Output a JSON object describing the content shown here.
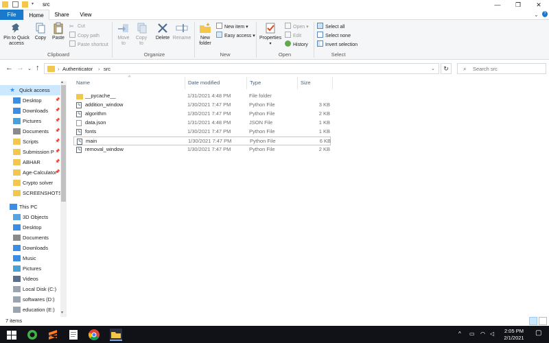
{
  "window": {
    "title": "src",
    "controls": {
      "minimize": "—",
      "maximize": "❐",
      "close": "✕"
    }
  },
  "tabs": {
    "file": "File",
    "home": "Home",
    "share": "Share",
    "view": "View"
  },
  "ribbon": {
    "clipboard": {
      "label": "Clipboard",
      "pin": "Pin to Quick access",
      "copy": "Copy",
      "paste": "Paste",
      "cut": "Cut",
      "copy_path": "Copy path",
      "paste_shortcut": "Paste shortcut"
    },
    "organize": {
      "label": "Organize",
      "move_to": "Move to",
      "copy_to": "Copy to",
      "delete": "Delete",
      "rename": "Rename"
    },
    "new": {
      "label": "New",
      "new_folder": "New folder",
      "new_item": "New item",
      "easy_access": "Easy access"
    },
    "open": {
      "label": "Open",
      "properties": "Properties",
      "open": "Open",
      "edit": "Edit",
      "history": "History"
    },
    "select": {
      "label": "Select",
      "select_all": "Select all",
      "select_none": "Select none",
      "invert": "Invert selection"
    }
  },
  "address": {
    "crumbs": [
      "Authenticator",
      "src"
    ],
    "search_placeholder": "Search src"
  },
  "nav": {
    "quick_access": "Quick access",
    "pinned": [
      {
        "label": "Desktop",
        "icon": "desktop-icon",
        "pinned": true
      },
      {
        "label": "Downloads",
        "icon": "downloads-icon",
        "pinned": true
      },
      {
        "label": "Pictures",
        "icon": "pictures-icon",
        "pinned": true
      },
      {
        "label": "Documents",
        "icon": "documents-icon",
        "pinned": true
      },
      {
        "label": "Scripts",
        "icon": "folder-icon",
        "pinned": true
      },
      {
        "label": "Submission P",
        "icon": "folder-icon",
        "pinned": true
      },
      {
        "label": "ABHAR",
        "icon": "folder-icon",
        "pinned": true
      },
      {
        "label": "Age-Calculator",
        "icon": "folder-icon",
        "pinned": true
      },
      {
        "label": "Crypto solver",
        "icon": "folder-icon",
        "pinned": false
      },
      {
        "label": "SCREENSHOTS",
        "icon": "folder-icon",
        "pinned": false
      }
    ],
    "this_pc": "This PC",
    "pc_items": [
      {
        "label": "3D Objects",
        "icon": "objects-3d-icon"
      },
      {
        "label": "Desktop",
        "icon": "desktop-icon"
      },
      {
        "label": "Documents",
        "icon": "documents-icon"
      },
      {
        "label": "Downloads",
        "icon": "downloads-icon"
      },
      {
        "label": "Music",
        "icon": "music-icon"
      },
      {
        "label": "Pictures",
        "icon": "pictures-icon"
      },
      {
        "label": "Videos",
        "icon": "videos-icon"
      },
      {
        "label": "Local Disk (C:)",
        "icon": "drive-icon"
      },
      {
        "label": "softwares (D:)",
        "icon": "drive-icon"
      },
      {
        "label": "education (E:)",
        "icon": "drive-icon"
      }
    ]
  },
  "columns": {
    "name": "Name",
    "date": "Date modified",
    "type": "Type",
    "size": "Size"
  },
  "files": [
    {
      "name": "__pycache__",
      "date": "1/31/2021 4:48 PM",
      "type": "File folder",
      "size": "",
      "icon": "folder-icon"
    },
    {
      "name": "addition_window",
      "date": "1/30/2021 7:47 PM",
      "type": "Python File",
      "size": "3 KB",
      "icon": "python-file-icon"
    },
    {
      "name": "algorithm",
      "date": "1/30/2021 7:47 PM",
      "type": "Python File",
      "size": "2 KB",
      "icon": "python-file-icon"
    },
    {
      "name": "data.json",
      "date": "1/31/2021 4:48 PM",
      "type": "JSON File",
      "size": "1 KB",
      "icon": "json-file-icon"
    },
    {
      "name": "fonts",
      "date": "1/30/2021 7:47 PM",
      "type": "Python File",
      "size": "1 KB",
      "icon": "python-file-icon"
    },
    {
      "name": "main",
      "date": "1/30/2021 7:47 PM",
      "type": "Python File",
      "size": "6 KB",
      "icon": "python-file-icon",
      "selected": true
    },
    {
      "name": "removal_window",
      "date": "1/30/2021 7:47 PM",
      "type": "Python File",
      "size": "2 KB",
      "icon": "python-file-icon"
    }
  ],
  "status": {
    "items": "7 items"
  },
  "taskbar": {
    "time": "2:05 PM",
    "date": "2/1/2021",
    "apps": [
      "windows-start-icon",
      "anaconda-icon",
      "sublime-icon",
      "notepad-icon",
      "chrome-icon",
      "file-explorer-icon"
    ]
  },
  "colors": {
    "accent": "#1979ca",
    "folder": "#f3c74b",
    "selection": "#cce8ff",
    "taskbar": "#101217"
  }
}
